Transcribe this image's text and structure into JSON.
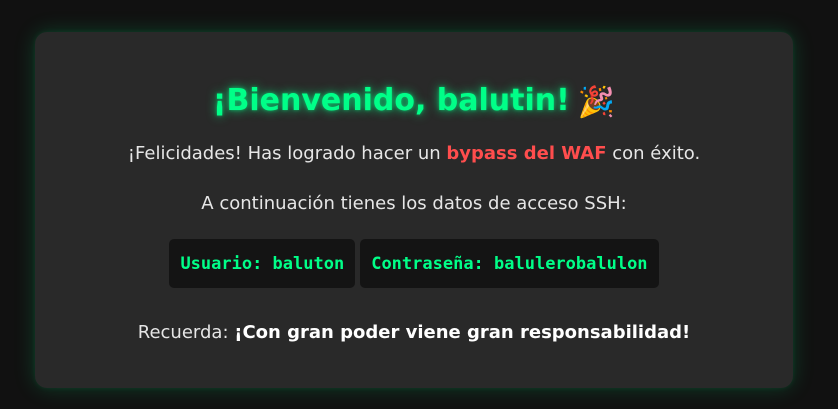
{
  "welcome": {
    "title": "¡Bienvenido, balutin!",
    "emoji": "🎉"
  },
  "message": {
    "prefix": "¡Felicidades! Has logrado hacer un ",
    "highlight": "bypass del WAF",
    "suffix": " con éxito."
  },
  "ssh_intro": "A continuación tienes los datos de acceso SSH:",
  "credentials": {
    "user": "Usuario: baluton",
    "password": "Contraseña: balulerobalulon"
  },
  "reminder": {
    "prefix": "Recuerda: ",
    "bold": "¡Con gran poder viene gran responsabilidad!"
  },
  "colors": {
    "accent": "#00ff88",
    "highlight": "#ff4d4d",
    "background": "#111111",
    "card": "#292929"
  }
}
